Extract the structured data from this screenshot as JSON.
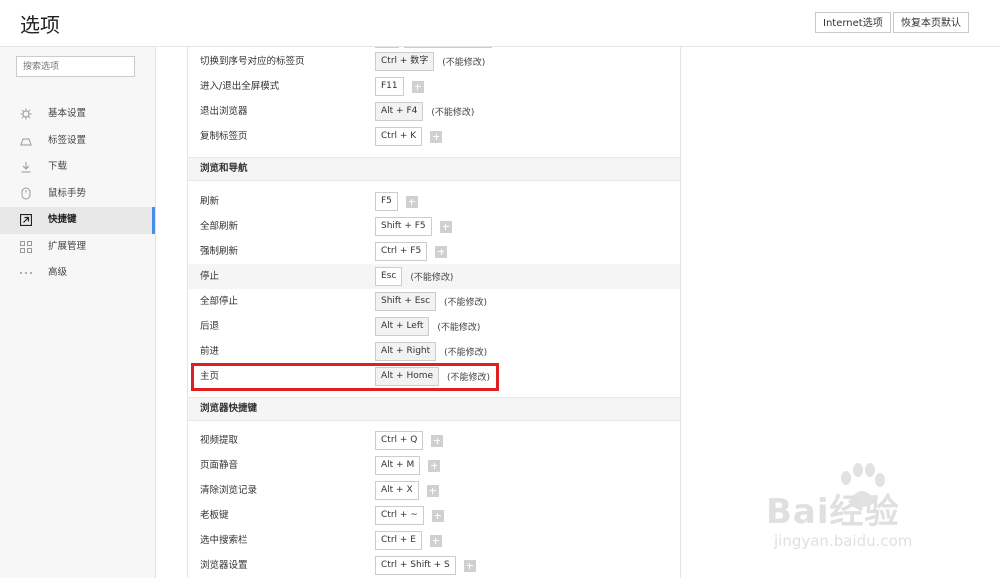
{
  "header": {
    "title": "选项",
    "btn_internet": "Internet选项",
    "btn_restore": "恢复本页默认"
  },
  "sidebar": {
    "search_placeholder": "搜索选项",
    "items": [
      {
        "label": "基本设置",
        "icon": "gear-icon"
      },
      {
        "label": "标签设置",
        "icon": "tab-icon"
      },
      {
        "label": "下载",
        "icon": "download-icon"
      },
      {
        "label": "鼠标手势",
        "icon": "mouse-icon"
      },
      {
        "label": "快捷键",
        "icon": "shortcut-icon",
        "active": true
      },
      {
        "label": "扩展管理",
        "icon": "grid-icon"
      },
      {
        "label": "高级",
        "icon": "more-icon"
      }
    ]
  },
  "colors": {
    "accent": "#4a8fe7",
    "highlight": "#e02020"
  },
  "note_label": "(不能修改)",
  "group1": [
    {
      "name": "切换到序号对应的标签页",
      "key": "Ctrl + 数字",
      "fixed": true
    },
    {
      "name": "进入/退出全屏模式",
      "key": "F11",
      "fixed": false
    },
    {
      "name": "退出浏览器",
      "key": "Alt + F4",
      "fixed": true
    },
    {
      "name": "复制标签页",
      "key": "Ctrl + K",
      "fixed": false
    }
  ],
  "section_nav": "浏览和导航",
  "group2": [
    {
      "name": "刷新",
      "key": "F5",
      "fixed": false
    },
    {
      "name": "全部刷新",
      "key": "Shift + F5",
      "fixed": false
    },
    {
      "name": "强制刷新",
      "key": "Ctrl + F5",
      "fixed": false
    },
    {
      "name": "停止",
      "key": "Esc",
      "fixed": true
    },
    {
      "name": "全部停止",
      "key": "Shift + Esc",
      "fixed": true
    },
    {
      "name": "后退",
      "key": "Alt + Left",
      "fixed": true
    },
    {
      "name": "前进",
      "key": "Alt + Right",
      "fixed": true
    },
    {
      "name": "主页",
      "key": "Alt + Home",
      "fixed": true
    }
  ],
  "section_browser": "浏览器快捷键",
  "group3": [
    {
      "name": "视频提取",
      "key": "Ctrl + Q",
      "fixed": false
    },
    {
      "name": "页面静音",
      "key": "Alt + M",
      "fixed": false
    },
    {
      "name": "清除浏览记录",
      "key": "Alt + X",
      "fixed": false
    },
    {
      "name": "老板键",
      "key": "Ctrl + ~",
      "fixed": false
    },
    {
      "name": "选中搜索栏",
      "key": "Ctrl + E",
      "fixed": false
    },
    {
      "name": "浏览器设置",
      "key": "Ctrl + Shift + S",
      "fixed": false
    }
  ],
  "watermark": {
    "brand": "Bai经验",
    "url": "jingyan.baidu.com"
  }
}
